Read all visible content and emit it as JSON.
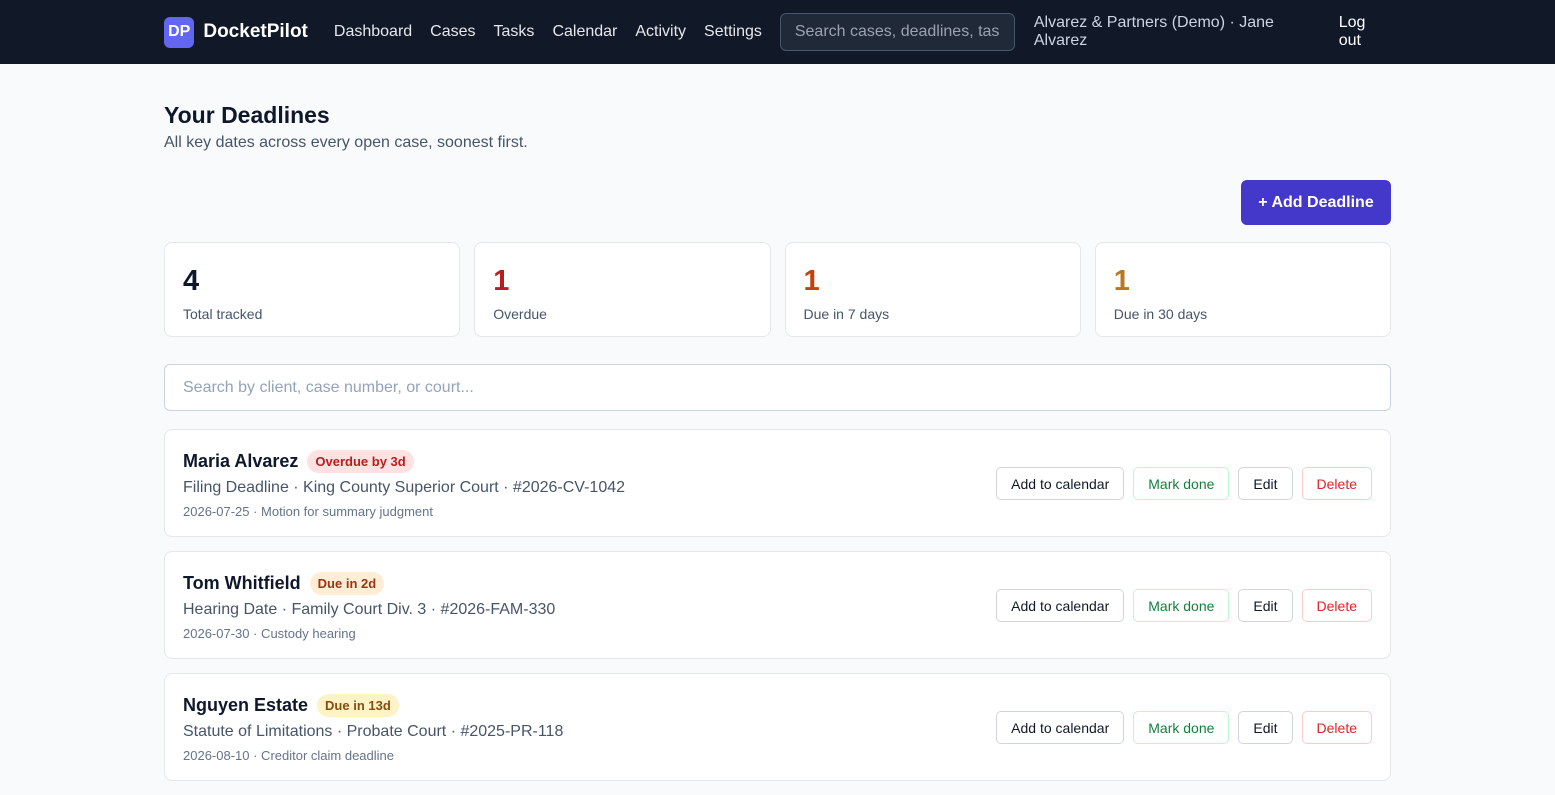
{
  "header": {
    "logo_mark": "DP",
    "app_name": "DocketPilot",
    "nav": [
      "Dashboard",
      "Cases",
      "Tasks",
      "Calendar",
      "Activity",
      "Settings"
    ],
    "search_placeholder": "Search cases, deadlines, tasks",
    "org_user": "Alvarez & Partners (Demo) · Jane Alvarez",
    "logout": "Log out"
  },
  "page": {
    "title": "Your Deadlines",
    "subtitle": "All key dates across every open case, soonest first.",
    "add_button": "+ Add Deadline"
  },
  "stats": [
    {
      "value": "4",
      "label": "Total tracked",
      "color": "#0f172a"
    },
    {
      "value": "1",
      "label": "Overdue",
      "color": "#b91c1c"
    },
    {
      "value": "1",
      "label": "Due in 7 days",
      "color": "#c2410c"
    },
    {
      "value": "1",
      "label": "Due in 30 days",
      "color": "#b7791f"
    }
  ],
  "list_search_placeholder": "Search by client, case number, or court...",
  "actions": {
    "calendar": "Add to calendar",
    "done": "Mark done",
    "edit": "Edit",
    "delete": "Delete"
  },
  "deadlines": [
    {
      "client": "Maria Alvarez",
      "badge": "Overdue by 3d",
      "badge_bg": "#fee2e2",
      "badge_fg": "#b91c1c",
      "details": "Filing Deadline · King County Superior Court · #2026-CV-1042",
      "meta": "2026-07-25 · Motion for summary judgment"
    },
    {
      "client": "Tom Whitfield",
      "badge": "Due in 2d",
      "badge_bg": "#ffedd5",
      "badge_fg": "#9a3412",
      "details": "Hearing Date · Family Court Div. 3 · #2026-FAM-330",
      "meta": "2026-07-30 · Custody hearing"
    },
    {
      "client": "Nguyen Estate",
      "badge": "Due in 13d",
      "badge_bg": "#fef3c7",
      "badge_fg": "#854d0e",
      "details": "Statute of Limitations · Probate Court · #2025-PR-118",
      "meta": "2026-08-10 · Creditor claim deadline"
    }
  ]
}
